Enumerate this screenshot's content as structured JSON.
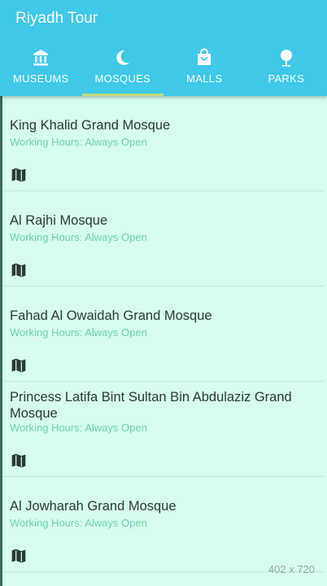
{
  "app": {
    "title": "Riyadh Tour"
  },
  "tabs": [
    {
      "label": "MUSEUMS",
      "icon": "museum-icon",
      "active": false
    },
    {
      "label": "MOSQUES",
      "icon": "moon-icon",
      "active": true
    },
    {
      "label": "MALLS",
      "icon": "shopping-bag-icon",
      "active": false
    },
    {
      "label": "PARKS",
      "icon": "tree-icon",
      "active": false
    }
  ],
  "places": [
    {
      "name": "King Khalid Grand Mosque",
      "hours": "Working Hours: Always Open"
    },
    {
      "name": "Al Rajhi Mosque",
      "hours": "Working Hours: Always Open"
    },
    {
      "name": "Fahad Al Owaidah Grand Mosque",
      "hours": "Working Hours: Always Open"
    },
    {
      "name": "Princess Latifa Bint Sultan Bin Abdulaziz Grand Mosque",
      "hours": "Working Hours: Always Open"
    },
    {
      "name": "Al Jowharah Grand Mosque",
      "hours": "Working Hours: Always Open"
    }
  ],
  "overlay": {
    "dimensions": "402 x 720"
  },
  "colors": {
    "appbar": "#3fc8e8",
    "background": "#d6fbef",
    "hours_text": "#6ed2a8",
    "indicator": "#c6d97a"
  }
}
